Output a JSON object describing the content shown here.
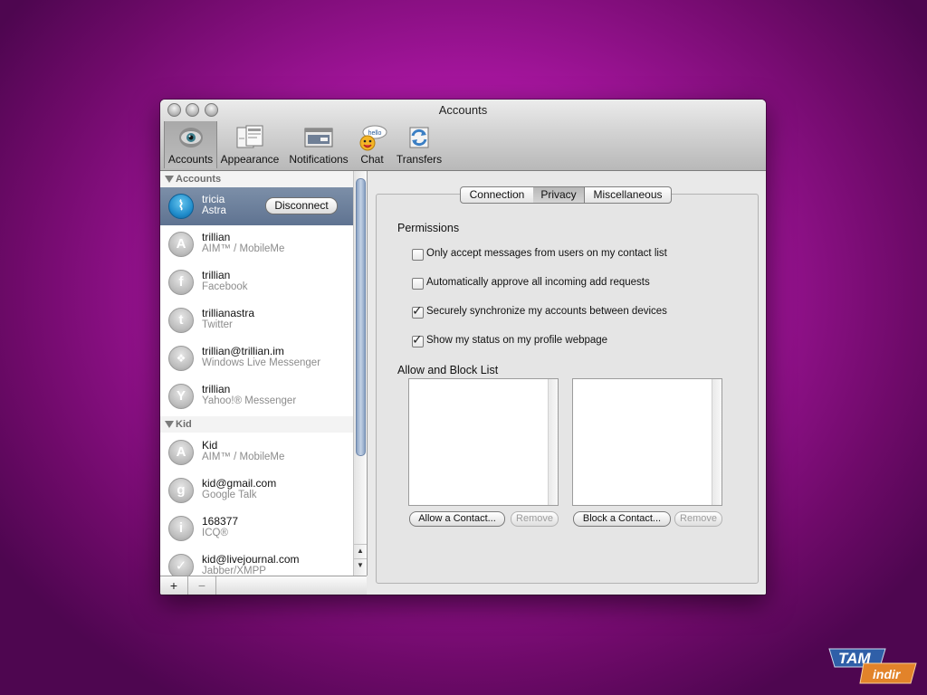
{
  "window": {
    "title": "Accounts"
  },
  "toolbar": {
    "items": [
      {
        "label": "Accounts",
        "icon": "eye-icon",
        "selected": true
      },
      {
        "label": "Appearance",
        "icon": "windows-icon"
      },
      {
        "label": "Notifications",
        "icon": "notification-window-icon"
      },
      {
        "label": "Chat",
        "icon": "chat-bubble-icon",
        "icon_text": "hello"
      },
      {
        "label": "Transfers",
        "icon": "transfer-arrows-icon"
      }
    ]
  },
  "sidebar": {
    "groups": [
      {
        "label": "Accounts"
      },
      {
        "label": "Kid"
      }
    ],
    "accounts": [
      {
        "name": "tricia",
        "service": "Astra",
        "icon": "astra-icon",
        "glyph": "⌇",
        "selected": true
      },
      {
        "name": "trillian",
        "service": "AIM™ / MobileMe",
        "icon": "aim-icon",
        "glyph": "A"
      },
      {
        "name": "trillian",
        "service": "Facebook",
        "icon": "facebook-icon",
        "glyph": "f"
      },
      {
        "name": "trillianastra",
        "service": "Twitter",
        "icon": "twitter-icon",
        "glyph": "t"
      },
      {
        "name": "trillian@trillian.im",
        "service": "Windows Live Messenger",
        "icon": "windows-live-icon",
        "glyph": "❖"
      },
      {
        "name": "trillian",
        "service": "Yahoo!® Messenger",
        "icon": "yahoo-icon",
        "glyph": "Y"
      },
      {
        "name": "Kid",
        "service": "AIM™ / MobileMe",
        "icon": "aim-icon",
        "glyph": "A"
      },
      {
        "name": "kid@gmail.com",
        "service": "Google Talk",
        "icon": "google-talk-icon",
        "glyph": "g"
      },
      {
        "name": "168377",
        "service": "ICQ®",
        "icon": "icq-icon",
        "glyph": "i"
      },
      {
        "name": "kid@livejournal.com",
        "service": "Jabber/XMPP",
        "icon": "jabber-icon",
        "glyph": "✓"
      }
    ],
    "disconnect_label": "Disconnect",
    "add_label": "+",
    "remove_label": "−"
  },
  "tabs": [
    {
      "label": "Connection"
    },
    {
      "label": "Privacy",
      "selected": true
    },
    {
      "label": "Miscellaneous"
    }
  ],
  "permissions": {
    "title": "Permissions",
    "options": [
      {
        "label": "Only accept messages from users on my contact list",
        "checked": false
      },
      {
        "label": "Automatically approve all incoming add requests",
        "checked": false
      },
      {
        "label": "Securely synchronize my accounts between devices",
        "checked": true
      },
      {
        "label": "Show my status on my profile webpage",
        "checked": true
      }
    ]
  },
  "allow_block": {
    "title": "Allow and Block List",
    "allow_button": "Allow a Contact...",
    "allow_remove": "Remove",
    "block_button": "Block a Contact...",
    "block_remove": "Remove"
  },
  "watermark": {
    "line1": "TAM",
    "line2": "indir"
  },
  "colors": {
    "background": "#b41cab",
    "selection": "#6d819d"
  }
}
